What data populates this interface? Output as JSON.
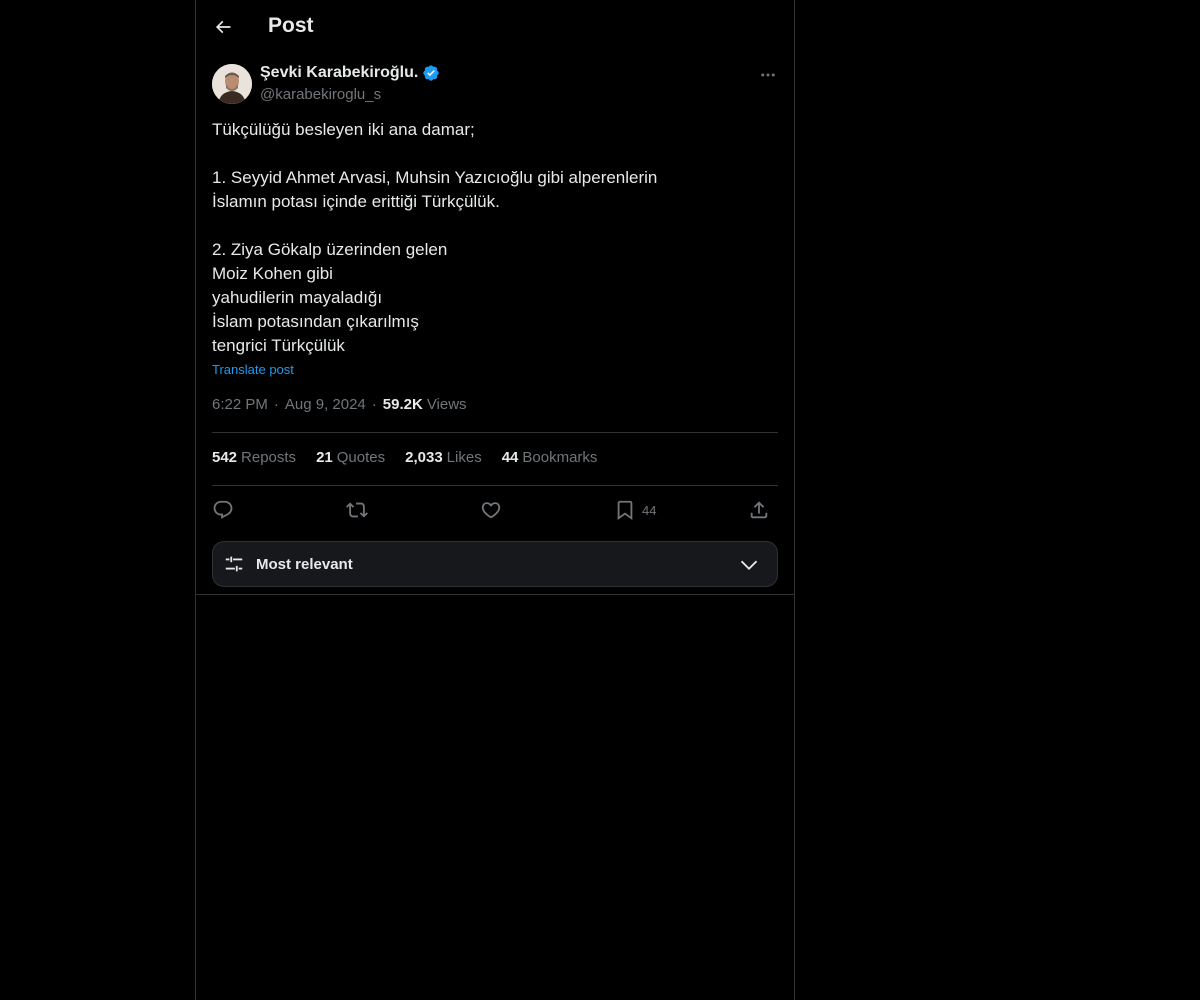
{
  "header": {
    "title": "Post",
    "back_icon": "arrow-left-icon"
  },
  "author": {
    "name": "Şevki Karabekiroğlu.",
    "handle": "@karabekiroglu_s",
    "verified_icon": "verified-badge-icon"
  },
  "post": {
    "lines": [
      "Tükçülüğü besleyen iki ana damar;",
      "",
      "1. Seyyid Ahmet Arvasi, Muhsin Yazıcıoğlu gibi alperenlerin",
      "İslamın potası içinde erittiği Türkçülük.",
      "",
      "2. Ziya Gökalp üzerinden gelen",
      "Moiz Kohen gibi",
      "yahudilerin mayaladığı",
      "İslam potasından çıkarılmış",
      "tengrici Türkçülük"
    ],
    "translate_label": "Translate post"
  },
  "meta": {
    "time": "6:22 PM",
    "separator": "·",
    "date": "Aug 9, 2024",
    "views_count": "59.2K",
    "views_label": "Views"
  },
  "stats": {
    "reposts_count": "542",
    "reposts_label": "Reposts",
    "quotes_count": "21",
    "quotes_label": "Quotes",
    "likes_count": "2,033",
    "likes_label": "Likes",
    "bookmarks_count": "44",
    "bookmarks_label": "Bookmarks"
  },
  "actions": {
    "reply_icon": "reply-icon",
    "repost_icon": "repost-icon",
    "like_icon": "heart-icon",
    "bookmark_icon": "bookmark-icon",
    "bookmark_count": "44",
    "share_icon": "share-icon"
  },
  "sort": {
    "label": "Most relevant",
    "icon": "sliders-icon",
    "chevron": "chevron-down-icon"
  },
  "colors": {
    "background": "#000000",
    "text": "#e7e9ea",
    "muted": "#71767b",
    "accent": "#1d9bf0",
    "border": "#2f3336"
  }
}
